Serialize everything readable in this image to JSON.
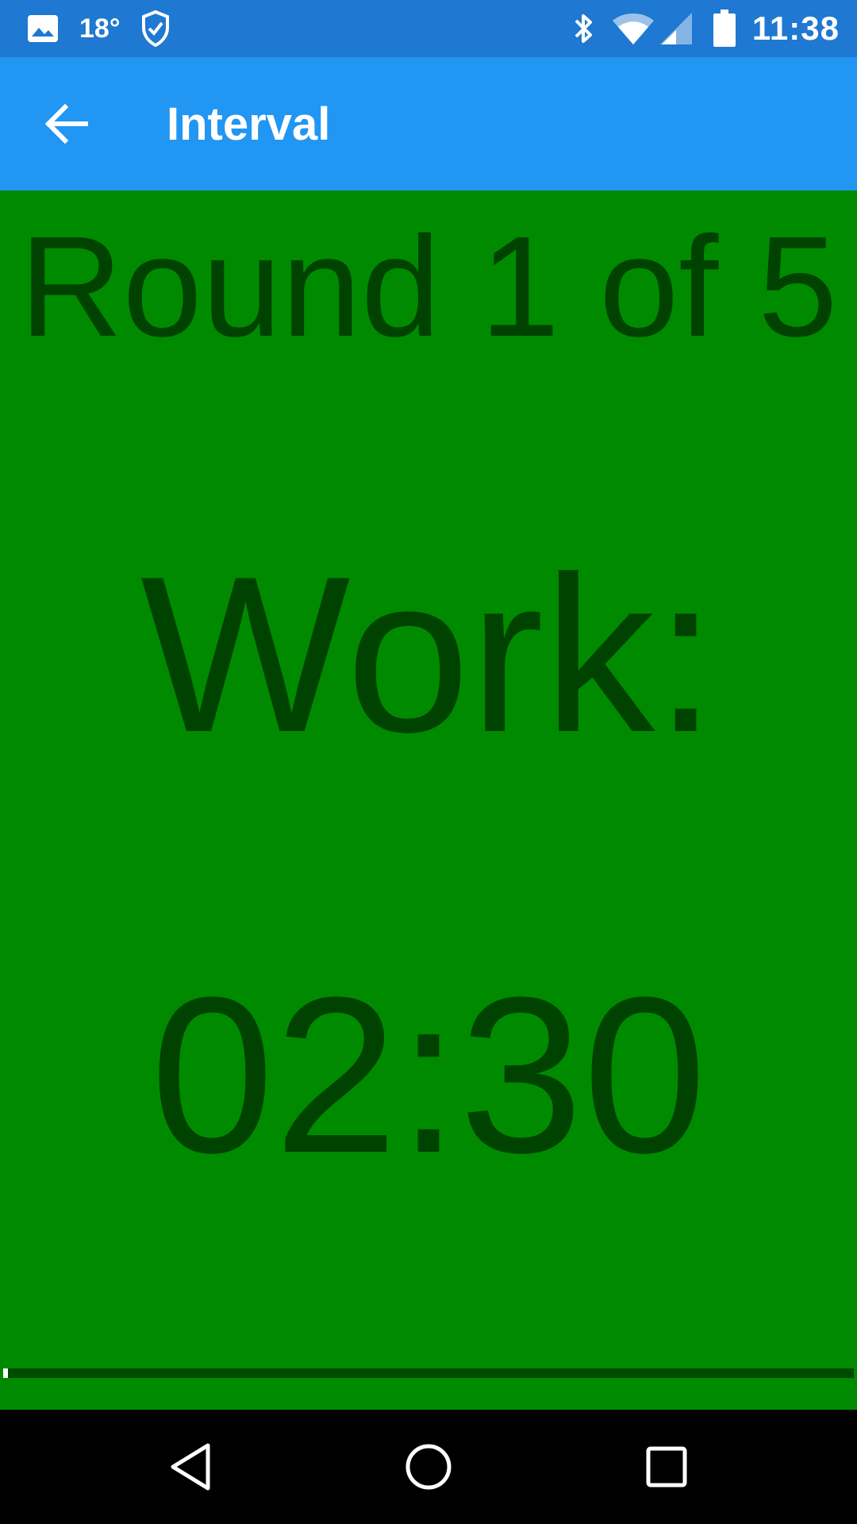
{
  "status_bar": {
    "temperature": "18°",
    "time": "11:38",
    "icons": [
      "image-icon",
      "shield-check-icon",
      "bluetooth-icon",
      "wifi-icon",
      "cell-signal-icon",
      "battery-icon"
    ]
  },
  "app_bar": {
    "title": "Interval",
    "back_icon": "arrow-back-icon"
  },
  "main": {
    "round_text": "Round 1 of 5",
    "phase_text": "Work:",
    "timer": "02:30",
    "progress": 0.005
  },
  "nav_bar": {
    "icons": [
      "nav-back-icon",
      "nav-home-icon",
      "nav-recents-icon"
    ]
  },
  "colors": {
    "status_bar": "#1f78d1",
    "app_bar": "#2196f3",
    "background": "#008a00",
    "text": "#004200",
    "progress_track": "#004a00"
  }
}
